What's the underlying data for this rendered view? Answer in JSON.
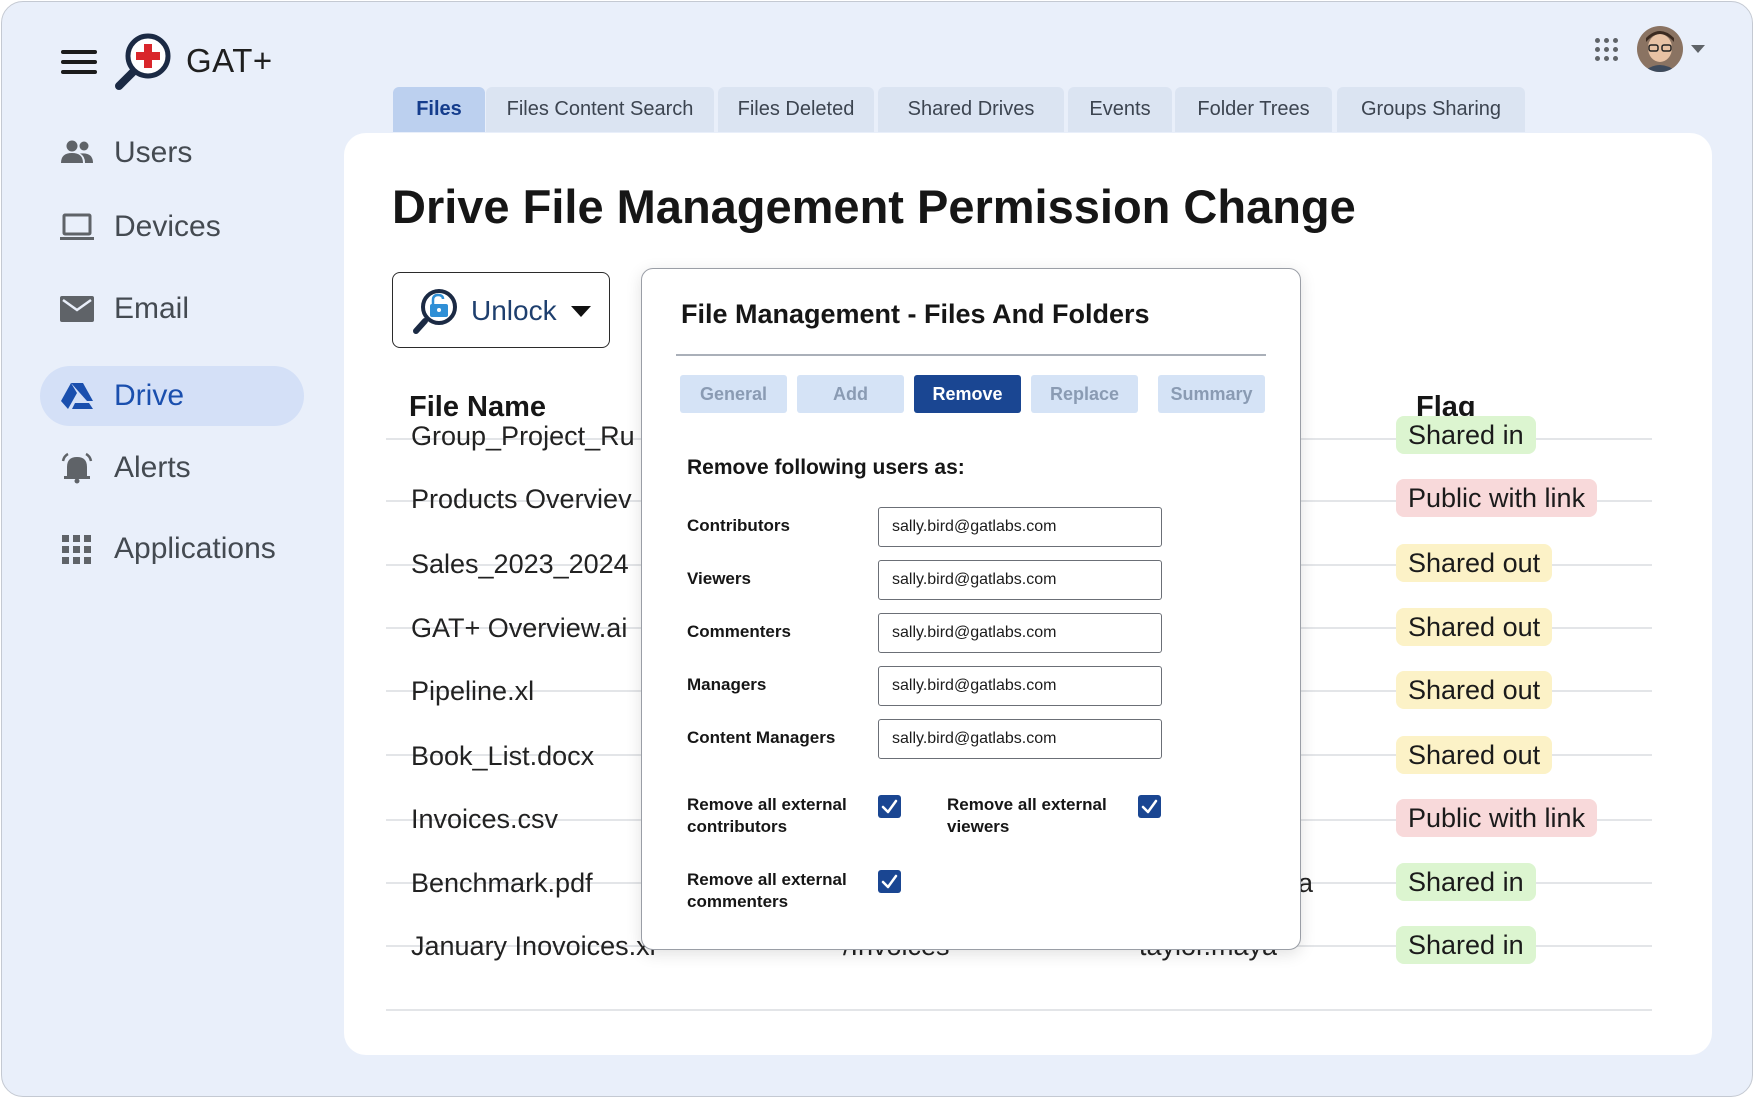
{
  "app": {
    "name": "GAT+"
  },
  "sidebar": {
    "items": [
      {
        "label": "Users",
        "icon": "users-icon",
        "active": false
      },
      {
        "label": "Devices",
        "icon": "laptop-icon",
        "active": false
      },
      {
        "label": "Email",
        "icon": "envelope-icon",
        "active": false
      },
      {
        "label": "Drive",
        "icon": "google-drive-icon",
        "active": true
      },
      {
        "label": "Alerts",
        "icon": "bell-icon",
        "active": false
      },
      {
        "label": "Applications",
        "icon": "grid-icon",
        "active": false
      }
    ]
  },
  "tabs": [
    {
      "label": "Files",
      "active": true
    },
    {
      "label": "Files Content Search",
      "active": false
    },
    {
      "label": "Files Deleted",
      "active": false
    },
    {
      "label": "Shared Drives",
      "active": false
    },
    {
      "label": "Events",
      "active": false
    },
    {
      "label": "Folder Trees",
      "active": false
    },
    {
      "label": "Groups Sharing",
      "active": false
    }
  ],
  "main": {
    "title": "Drive File Management Permission Change",
    "unlock_label": "Unlock"
  },
  "table": {
    "columns": {
      "file_name": "File Name",
      "flag": "Flag"
    },
    "rows": [
      {
        "file_name": "Group_Project_Ru",
        "path": "",
        "owner": "",
        "flag": "Shared in",
        "flag_type": "in"
      },
      {
        "file_name": "Products Overviev",
        "path": "",
        "owner": "",
        "flag": "Public with link",
        "flag_type": "pub"
      },
      {
        "file_name": "Sales_2023_2024",
        "path": "",
        "owner": "",
        "flag": "Shared out",
        "flag_type": "out"
      },
      {
        "file_name": "GAT+ Overview.ai",
        "path": "",
        "owner": "",
        "flag": "Shared out",
        "flag_type": "out"
      },
      {
        "file_name": "Pipeline.xl",
        "path": "",
        "owner": "",
        "flag": "Shared out",
        "flag_type": "out"
      },
      {
        "file_name": "Book_List.docx",
        "path": "",
        "owner": "",
        "flag": "Shared out",
        "flag_type": "out"
      },
      {
        "file_name": "Invoices.csv",
        "path": "",
        "owner": "",
        "flag": "Public with link",
        "flag_type": "pub"
      },
      {
        "file_name": "Benchmark.pdf",
        "path": "",
        "owner": "a",
        "flag": "Shared in",
        "flag_type": "in"
      },
      {
        "file_name": "January Inovoices.xl",
        "path": "/Invoices",
        "owner": "taylor.maya",
        "flag": "Shared in",
        "flag_type": "in"
      }
    ]
  },
  "modal": {
    "title": "File Management - Files And Folders",
    "tabs": [
      {
        "label": "General",
        "active": false
      },
      {
        "label": "Add",
        "active": false
      },
      {
        "label": "Remove",
        "active": true
      },
      {
        "label": "Replace",
        "active": false
      },
      {
        "label": "Summary",
        "active": false
      }
    ],
    "section_heading": "Remove following users as:",
    "fields": [
      {
        "label": "Contributors",
        "value": "sally.bird@gatlabs.com"
      },
      {
        "label": "Viewers",
        "value": "sally.bird@gatlabs.com"
      },
      {
        "label": "Commenters",
        "value": "sally.bird@gatlabs.com"
      },
      {
        "label": "Managers",
        "value": "sally.bird@gatlabs.com"
      },
      {
        "label": "Content Managers",
        "value": "sally.bird@gatlabs.com"
      }
    ],
    "checkboxes": [
      {
        "label": "Remove all external contributors",
        "checked": true
      },
      {
        "label": "Remove all external viewers",
        "checked": true
      },
      {
        "label": "Remove all external commenters",
        "checked": true
      }
    ]
  },
  "colors": {
    "background": "#e9effa",
    "accent": "#1a4692",
    "nav_active_bg": "#d4e0f7",
    "flag_shared_in": "#dcf5d0",
    "flag_shared_out": "#fcf2c7",
    "flag_public": "#f8d9da"
  }
}
